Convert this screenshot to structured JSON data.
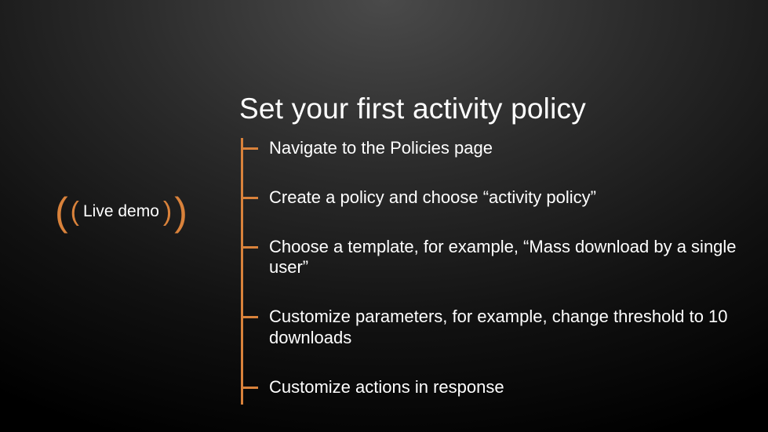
{
  "title": "Set your first activity policy",
  "badge": {
    "text": "Live demo"
  },
  "steps": [
    "Navigate to the Policies page",
    "Create a policy and choose “activity policy”",
    "Choose a template, for example, “Mass download by a single user”",
    "Customize parameters, for example, change threshold to 10 downloads",
    "Customize actions in response"
  ],
  "colors": {
    "accent": "#d9823b"
  }
}
